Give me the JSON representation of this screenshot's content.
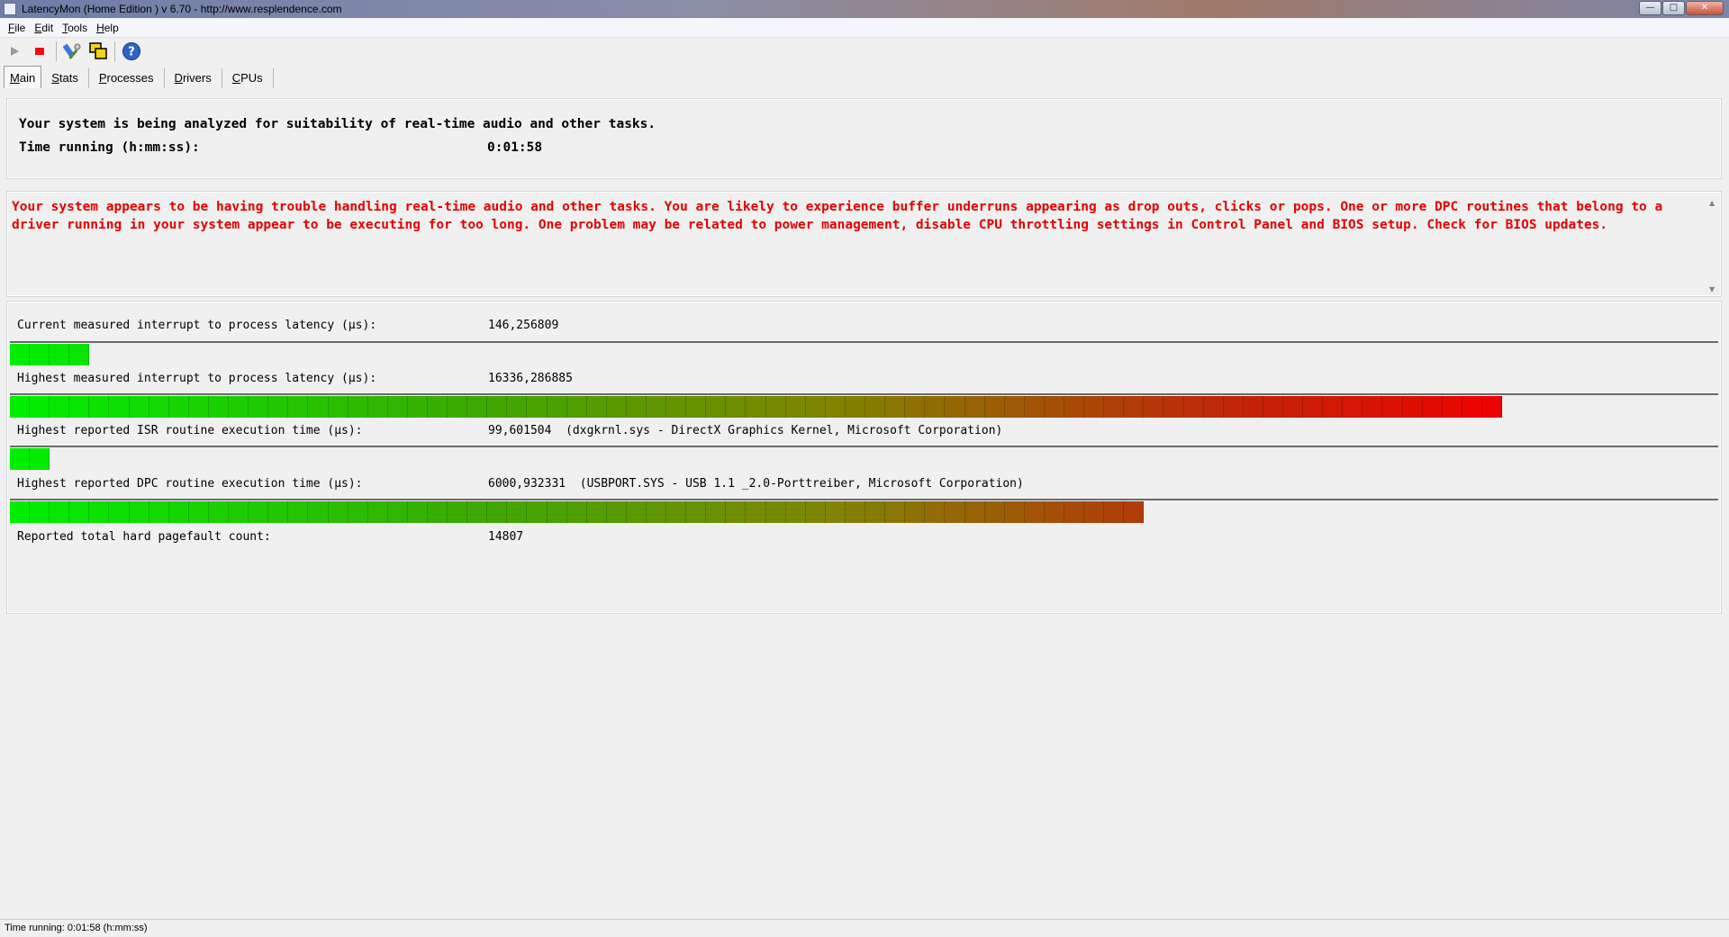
{
  "window": {
    "title": "LatencyMon  (Home Edition )  v 6.70 - http://www.resplendence.com"
  },
  "menu": [
    "File",
    "Edit",
    "Tools",
    "Help"
  ],
  "toolbar": {
    "icons": [
      "play-icon",
      "stop-icon",
      "tools-icon",
      "copy-windows-icon",
      "help-icon"
    ],
    "colors": {
      "stop": "#e81010",
      "help": "#2a66c8"
    }
  },
  "tabs": [
    "Main",
    "Stats",
    "Processes",
    "Drivers",
    "CPUs"
  ],
  "status": {
    "line1": "Your system is being analyzed for suitability of real-time audio and other tasks.",
    "time_label": "Time running (h:mm:ss):",
    "time_value": "0:01:58"
  },
  "warning": {
    "text": "Your system appears to be having trouble handling real-time audio and other tasks. You are likely to experience buffer underruns appearing as drop outs, clicks or pops. One or more DPC routines that belong to a driver running in your system appear to be executing for too long. One problem may be related to power management, disable CPU throttling settings in Control Panel and BIOS setup. Check for BIOS updates.",
    "color": "#e40000"
  },
  "metrics": [
    {
      "label": "Current measured interrupt to process latency (µs):",
      "value": "146,256809",
      "level": 0.044
    },
    {
      "label": "Highest measured interrupt to process latency (µs):",
      "value": "16336,286885",
      "level": 0.875
    },
    {
      "label": "Highest reported ISR routine execution time (µs):",
      "value": "99,601504  (dxgkrnl.sys - DirectX Graphics Kernel, Microsoft Corporation)",
      "level": 0.022
    },
    {
      "label": "Highest reported DPC routine execution time (µs):",
      "value": "6000,932331  (USBPORT.SYS - USB 1.1 _2.0-Porttreiber, Microsoft Corporation)",
      "level": 0.661
    },
    {
      "label": "Reported total hard pagefault count:",
      "value": "14807"
    }
  ],
  "statusbar": {
    "text": "Time running: 0:01:58  (h:mm:ss)"
  }
}
